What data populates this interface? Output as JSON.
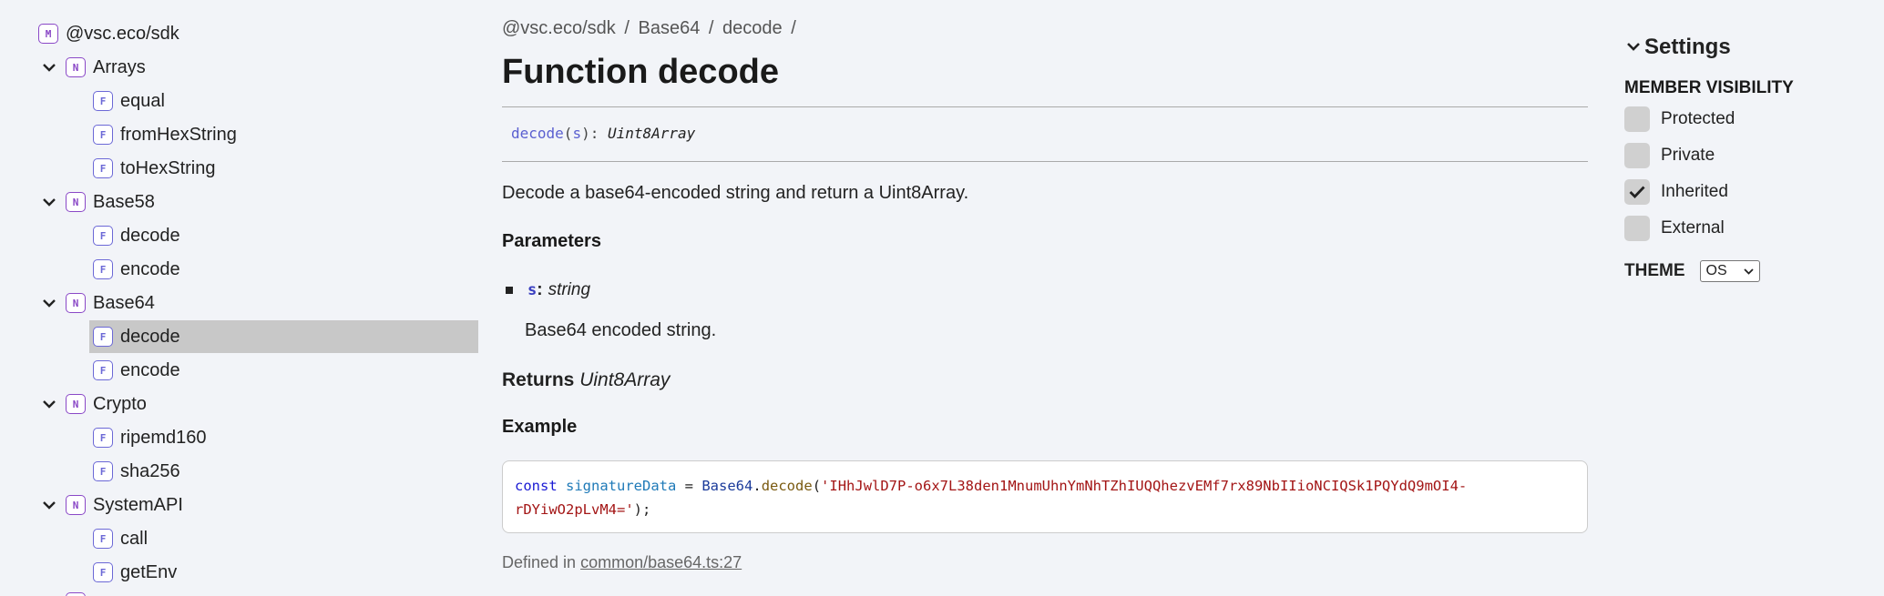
{
  "sidebar": {
    "root": {
      "kind": "M",
      "label": "@vsc.eco/sdk"
    },
    "items": [
      {
        "kind": "N",
        "label": "Arrays",
        "depth": 1,
        "expanded": true
      },
      {
        "kind": "F",
        "label": "equal",
        "depth": 2
      },
      {
        "kind": "F",
        "label": "fromHexString",
        "depth": 2
      },
      {
        "kind": "F",
        "label": "toHexString",
        "depth": 2
      },
      {
        "kind": "N",
        "label": "Base58",
        "depth": 1,
        "expanded": true
      },
      {
        "kind": "F",
        "label": "decode",
        "depth": 2
      },
      {
        "kind": "F",
        "label": "encode",
        "depth": 2
      },
      {
        "kind": "N",
        "label": "Base64",
        "depth": 1,
        "expanded": true
      },
      {
        "kind": "F",
        "label": "decode",
        "depth": 2,
        "selected": true
      },
      {
        "kind": "F",
        "label": "encode",
        "depth": 2
      },
      {
        "kind": "N",
        "label": "Crypto",
        "depth": 1,
        "expanded": true
      },
      {
        "kind": "F",
        "label": "ripemd160",
        "depth": 2
      },
      {
        "kind": "F",
        "label": "sha256",
        "depth": 2
      },
      {
        "kind": "N",
        "label": "SystemAPI",
        "depth": 1,
        "expanded": true
      },
      {
        "kind": "F",
        "label": "call",
        "depth": 2
      },
      {
        "kind": "F",
        "label": "getEnv",
        "depth": 2
      }
    ]
  },
  "breadcrumb": [
    "@vsc.eco/sdk",
    "/",
    "Base64",
    "/",
    "decode",
    "/"
  ],
  "title": "Function decode",
  "signature": {
    "name": "decode",
    "open": "(",
    "param": "s",
    "close": "): ",
    "return_type": "Uint8Array"
  },
  "description": "Decode a base64-encoded string and return a Uint8Array.",
  "parameters": {
    "heading": "Parameters",
    "items": [
      {
        "name": "s",
        "colon": ":",
        "type": "string",
        "description": "Base64 encoded string."
      }
    ]
  },
  "returns": {
    "label": "Returns",
    "type": "Uint8Array"
  },
  "example": {
    "heading": "Example",
    "line1": {
      "kw": "const",
      "var": "signatureData",
      "eq": " = ",
      "obj": "Base64",
      "dot": ".",
      "fn": "decode",
      "paren": "(",
      "str": "'IHhJwlD7P-o6x7L38den1MnumUhnYmNhTZhIUQQhezvEMf7rx89NbIIioNCIQSk1PQYdQ9mOI4-"
    },
    "line2": {
      "str": "rDYiwO2pLvM4='",
      "end": ");"
    }
  },
  "defined_in": {
    "label": "Defined in",
    "link": "common/base64.ts:27"
  },
  "settings": {
    "heading": "Settings",
    "member_visibility": "MEMBER VISIBILITY",
    "options": [
      {
        "label": "Protected",
        "checked": false
      },
      {
        "label": "Private",
        "checked": false
      },
      {
        "label": "Inherited",
        "checked": true
      },
      {
        "label": "External",
        "checked": false
      }
    ],
    "theme_label": "THEME",
    "theme_value": "OS"
  },
  "colors": {
    "background": "#f2f4f8",
    "namespace_badge": "#8a48c7",
    "function_badge": "#6b68d6",
    "selected_row": "#c8c8c8"
  }
}
